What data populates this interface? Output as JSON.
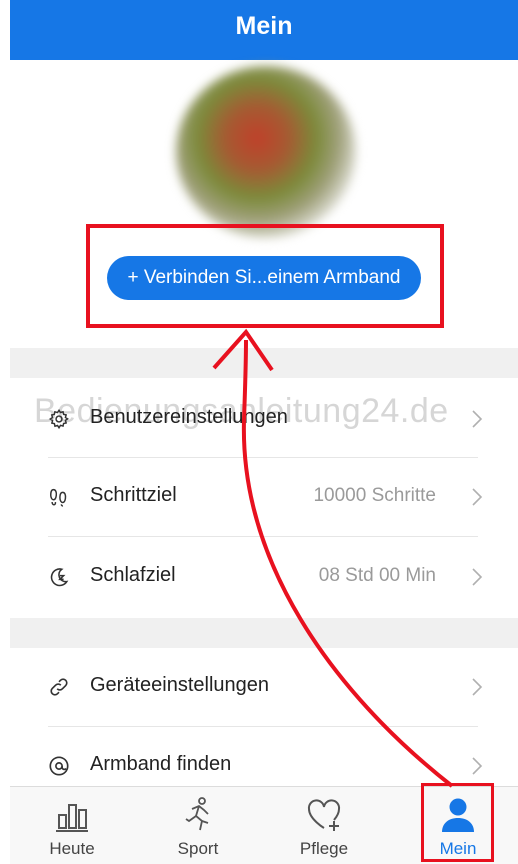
{
  "header": {
    "title": "Mein"
  },
  "profile": {
    "connect_button_label": "+ Verbinden Si...einem Armband"
  },
  "watermark": "Bedienungsanleitung24.de",
  "settings_group_1": [
    {
      "id": "benutzereinstellungen",
      "label": "Benutzereinstellungen",
      "value": "",
      "icon": "gear-icon"
    },
    {
      "id": "schrittziel",
      "label": "Schrittziel",
      "value": "10000 Schritte",
      "icon": "footprints-icon"
    },
    {
      "id": "schlafziel",
      "label": "Schlafziel",
      "value": "08 Std 00 Min",
      "icon": "moon-icon"
    }
  ],
  "settings_group_2": [
    {
      "id": "geraeteeinstellungen",
      "label": "Geräteeinstellungen",
      "value": "",
      "icon": "link-icon"
    },
    {
      "id": "armband-finden",
      "label": "Armband finden",
      "value": "",
      "icon": "at-icon"
    }
  ],
  "tab_bar": {
    "tabs": [
      {
        "id": "heute",
        "label": "Heute",
        "icon": "bar-chart-icon",
        "active": false
      },
      {
        "id": "sport",
        "label": "Sport",
        "icon": "runner-icon",
        "active": false
      },
      {
        "id": "pflege",
        "label": "Pflege",
        "icon": "heart-plus-icon",
        "active": false
      },
      {
        "id": "mein",
        "label": "Mein",
        "icon": "person-icon",
        "active": true
      }
    ]
  },
  "colors": {
    "accent": "#1677e6",
    "annotation": "#e8111f",
    "separator": "#f0f0f0",
    "secondary_text": "#9a9a9a"
  }
}
